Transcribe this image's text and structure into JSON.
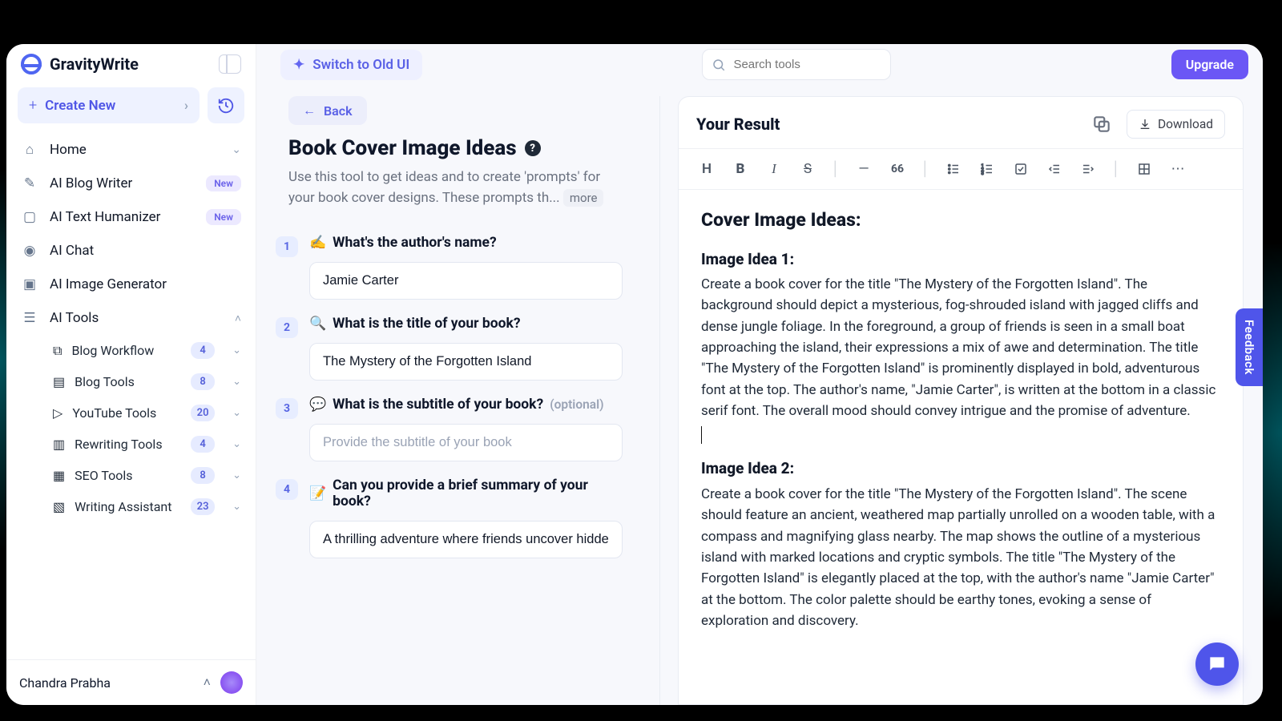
{
  "brand": "GravityWrite",
  "sidebar": {
    "create_label": "Create New",
    "home": "Home",
    "blog_writer": "AI Blog Writer",
    "humanizer": "AI Text Humanizer",
    "chat": "AI Chat",
    "image_gen": "AI Image Generator",
    "ai_tools": "AI Tools",
    "new_badge": "New",
    "sub": [
      {
        "label": "Blog Workflow",
        "count": "4"
      },
      {
        "label": "Blog Tools",
        "count": "8"
      },
      {
        "label": "YouTube Tools",
        "count": "20"
      },
      {
        "label": "Rewriting Tools",
        "count": "4"
      },
      {
        "label": "SEO Tools",
        "count": "8"
      },
      {
        "label": "Writing Assistant",
        "count": "23"
      }
    ],
    "user": "Chandra Prabha"
  },
  "topbar": {
    "switch": "Switch to Old UI",
    "search_placeholder": "Search tools",
    "upgrade": "Upgrade"
  },
  "form": {
    "back": "Back",
    "title": "Book Cover Image Ideas",
    "desc": "Use this tool to get ideas and to create 'prompts' for your book cover designs. These prompts th...",
    "more": "more",
    "q1": {
      "num": "1",
      "label": "What's the author's name?",
      "value": "Jamie Carter",
      "emoji": "✍️"
    },
    "q2": {
      "num": "2",
      "label": "What is the title of your book?",
      "value": "The Mystery of the Forgotten Island",
      "emoji": "🔍"
    },
    "q3": {
      "num": "3",
      "label": "What is the subtitle of your book?",
      "opt": "(optional)",
      "placeholder": "Provide the subtitle of your book",
      "emoji": "💬"
    },
    "q4": {
      "num": "4",
      "label": "Can you provide a brief summary of your book?",
      "value": "A thrilling adventure where friends uncover hidden secrets",
      "emoji": "📝"
    }
  },
  "result": {
    "header": "Your Result",
    "download": "Download",
    "heading": "Cover Image Ideas:",
    "idea1_title": "Image Idea 1:",
    "idea1_body": "Create a book cover for the title \"The Mystery of the Forgotten Island\". The background should depict a mysterious, fog-shrouded island with jagged cliffs and dense jungle foliage. In the foreground, a group of friends is seen in a small boat approaching the island, their expressions a mix of awe and determination. The title \"The Mystery of the Forgotten Island\" is prominently displayed in bold, adventurous font at the top. The author's name, \"Jamie Carter\", is written at the bottom in a classic serif font. The overall mood should convey intrigue and the promise of adventure.",
    "idea2_title": "Image Idea 2:",
    "idea2_body": "Create a book cover for the title \"The Mystery of the Forgotten Island\". The scene should feature an ancient, weathered map partially unrolled on a wooden table, with a compass and magnifying glass nearby. The map shows the outline of a mysterious island with marked locations and cryptic symbols. The title \"The Mystery of the Forgotten Island\" is elegantly placed at the top, with the author's name \"Jamie Carter\" at the bottom. The color palette should be earthy tones, evoking a sense of exploration and discovery."
  },
  "feedback": "Feedback"
}
